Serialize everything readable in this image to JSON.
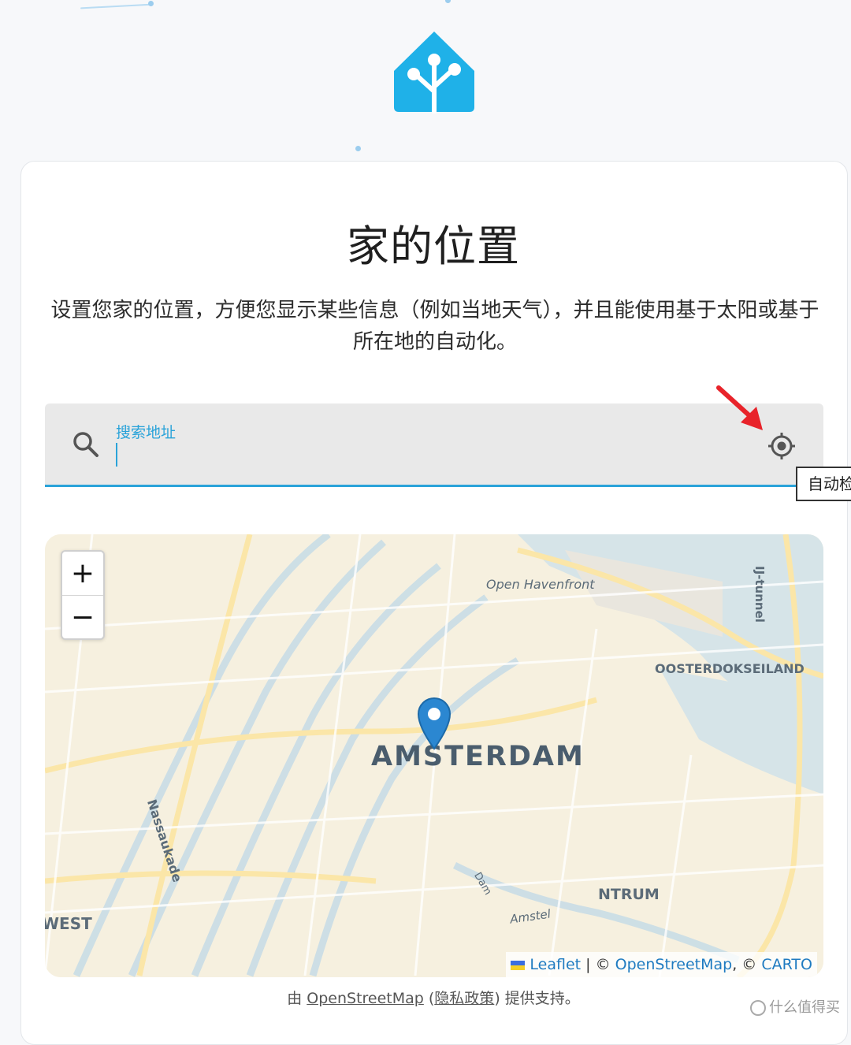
{
  "colors": {
    "accent": "#2aa3d9",
    "logo": "#1fb1e8",
    "arrow": "#e8232a"
  },
  "header": {
    "title": "家的位置"
  },
  "description": "设置您家的位置，方便您显示某些信息（例如当地天气），并且能使用基于太阳或基于所在地的自动化。",
  "search": {
    "label": "搜索地址",
    "value": "",
    "locate_icon": "crosshair-gps-icon",
    "search_icon": "magnify-icon"
  },
  "tooltip": {
    "text": "自动检测"
  },
  "map": {
    "zoom_in": "+",
    "zoom_out": "−",
    "labels": {
      "city": "AMSTERDAM",
      "harbour": "Open Havenfront",
      "island": "OOSTERDOKSEILAND",
      "tunnel": "IJ-tunnel",
      "street": "Nassaukade",
      "district_center": "NTRUM",
      "district_west": "WEST",
      "river": "Amstel",
      "canal": "Dam"
    },
    "attribution": {
      "leaflet": "Leaflet",
      "sep": " | © ",
      "osm": "OpenStreetMap",
      "sep2": ", © ",
      "carto": "CARTO"
    }
  },
  "footer": {
    "prefix": "由 ",
    "osm_link": "OpenStreetMap",
    "open": " (",
    "privacy_link": "隐私政策",
    "suffix": ") 提供支持。"
  },
  "watermark": "什么值得买"
}
